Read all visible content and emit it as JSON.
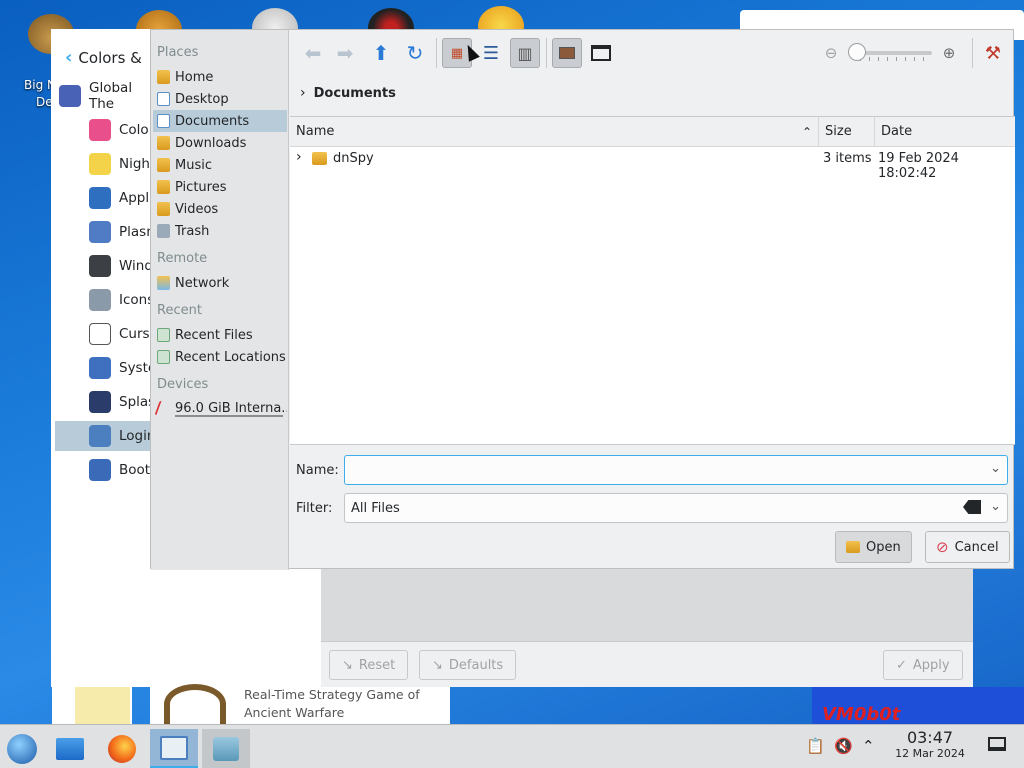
{
  "desktop": {
    "icon_label_1": "Big N",
    "icon_label_2": "De",
    "strip_text": [
      "Real-Time Strategy Game of",
      "Ancient Warfare"
    ],
    "strip_logo_text": "VM0b0t"
  },
  "settings": {
    "title": "Colors &",
    "items": [
      {
        "label": "Global The",
        "color": "#4a62b5"
      },
      {
        "label": "Color",
        "color": "#e94f8a"
      },
      {
        "label": "Night",
        "color": "#f3d34a"
      },
      {
        "label": "Appli",
        "color": "#2f6fbf"
      },
      {
        "label": "Plasm",
        "color": "#4f7cc4"
      },
      {
        "label": "Windo",
        "color": "#3c3f44"
      },
      {
        "label": "Icons",
        "color": "#8a9aa8"
      },
      {
        "label": "Curso",
        "color": "#ffffff"
      },
      {
        "label": "Syste",
        "color": "#3f6fbf"
      },
      {
        "label": "Splas",
        "color": "#2a3c6a"
      },
      {
        "label": "Login",
        "color": "#4c7fbf"
      },
      {
        "label": "Boot",
        "color": "#3a6ab8"
      }
    ],
    "selected_index": 10,
    "footer": {
      "reset": "Reset",
      "defaults": "Defaults",
      "apply": "Apply"
    }
  },
  "dialog": {
    "places": {
      "header": "Places",
      "items": [
        {
          "label": "Home",
          "icon": "folder-home-icon"
        },
        {
          "label": "Desktop",
          "icon": "desktop-icon"
        },
        {
          "label": "Documents",
          "icon": "folder-documents-icon"
        },
        {
          "label": "Downloads",
          "icon": "folder-downloads-icon"
        },
        {
          "label": "Music",
          "icon": "folder-music-icon"
        },
        {
          "label": "Pictures",
          "icon": "folder-pictures-icon"
        },
        {
          "label": "Videos",
          "icon": "folder-videos-icon"
        },
        {
          "label": "Trash",
          "icon": "trash-icon"
        }
      ]
    },
    "remote": {
      "header": "Remote",
      "items": [
        {
          "label": "Network",
          "icon": "network-icon"
        }
      ]
    },
    "recent": {
      "header": "Recent",
      "items": [
        {
          "label": "Recent Files",
          "icon": "recent-files-icon"
        },
        {
          "label": "Recent Locations",
          "icon": "recent-locations-icon"
        }
      ]
    },
    "devices": {
      "header": "Devices",
      "items": [
        {
          "label": "96.0 GiB Interna...",
          "icon": "drive-icon"
        }
      ]
    },
    "breadcrumb": "Documents",
    "columns": {
      "name": "Name",
      "size": "Size",
      "date": "Date"
    },
    "rows": [
      {
        "name": "dnSpy",
        "size": "3 items",
        "date": "19 Feb 2024 18:02:42"
      }
    ],
    "name_label": "Name:",
    "name_value": "",
    "filter_label": "Filter:",
    "filter_value": "All Files",
    "open_label": "Open",
    "cancel_label": "Cancel"
  },
  "taskbar": {
    "time": "03:47",
    "date": "12 Mar 2024"
  }
}
